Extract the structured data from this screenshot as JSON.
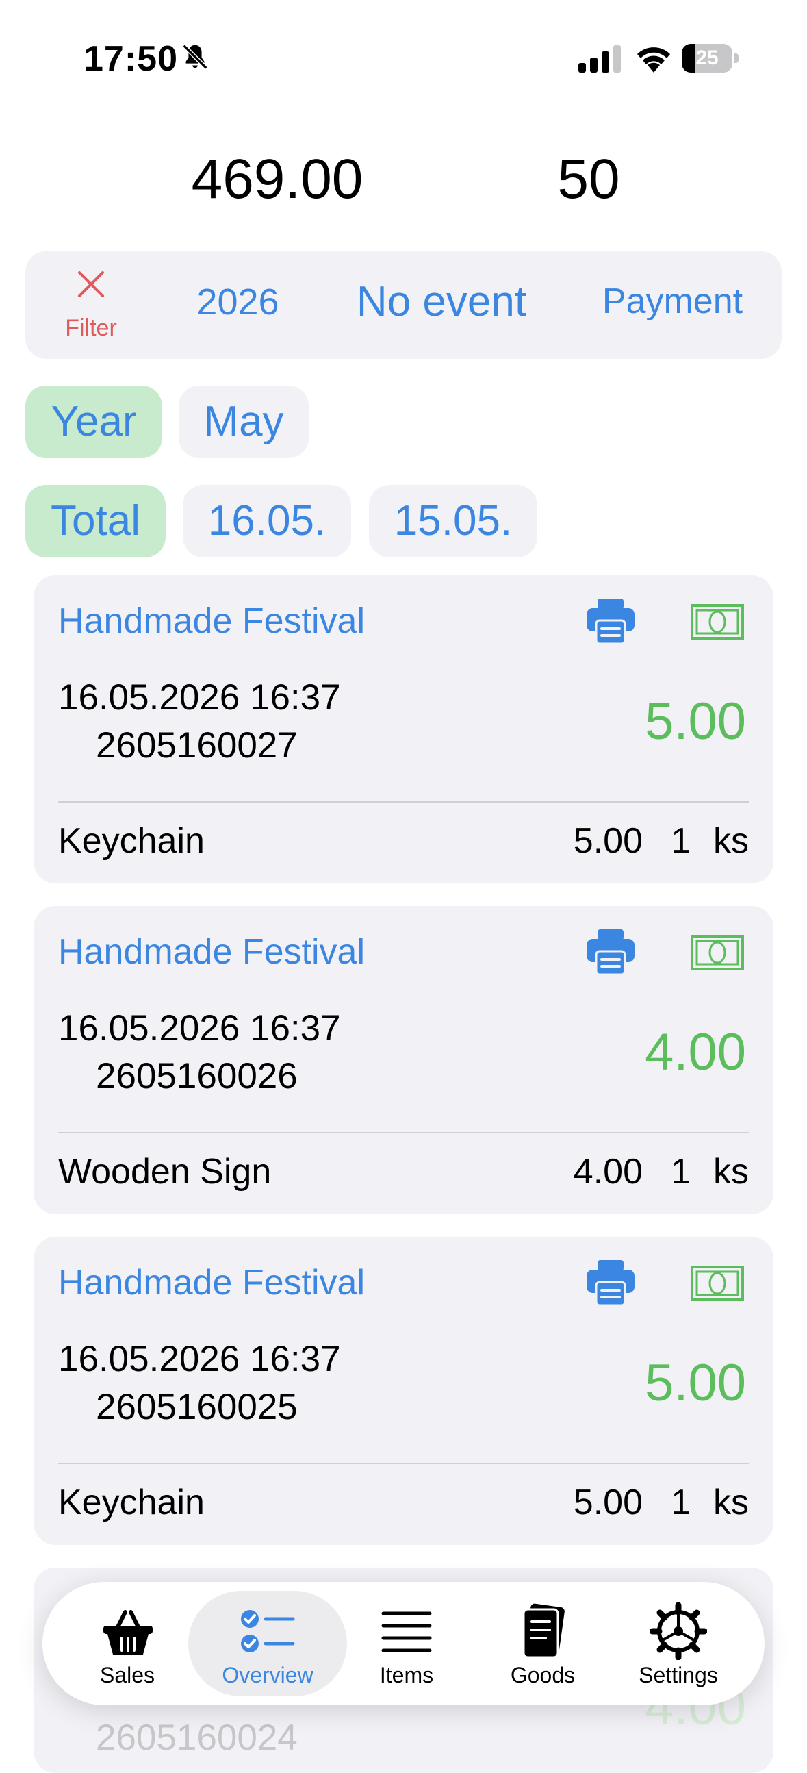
{
  "status_bar": {
    "time": "17:50",
    "battery": "25",
    "battery_level": 0.25
  },
  "summary": {
    "total": "469.00",
    "count": "50"
  },
  "filter_bar": {
    "filter_label": "Filter",
    "year": "2026",
    "event": "No event",
    "payment": "Payment"
  },
  "period_chips": [
    {
      "label": "Year",
      "active": true
    },
    {
      "label": "May",
      "active": false
    }
  ],
  "day_chips": [
    {
      "label": "Total",
      "active": true
    },
    {
      "label": "16.05.",
      "active": false
    },
    {
      "label": "15.05.",
      "active": false
    }
  ],
  "sales": [
    {
      "event": "Handmade Festival",
      "datetime": "16.05.2026 16:37",
      "number": "2605160027",
      "amount": "5.00",
      "item": "Keychain",
      "price": "5.00",
      "qty": "1",
      "unit": "ks"
    },
    {
      "event": "Handmade Festival",
      "datetime": "16.05.2026 16:37",
      "number": "2605160026",
      "amount": "4.00",
      "item": "Wooden Sign",
      "price": "4.00",
      "qty": "1",
      "unit": "ks"
    },
    {
      "event": "Handmade Festival",
      "datetime": "16.05.2026 16:37",
      "number": "2605160025",
      "amount": "5.00",
      "item": "Keychain",
      "price": "5.00",
      "qty": "1",
      "unit": "ks"
    }
  ],
  "partial_card": {
    "number": "2605160024",
    "amount": "4.00"
  },
  "tabs": [
    {
      "label": "Sales",
      "icon": "basket-icon"
    },
    {
      "label": "Overview",
      "icon": "checklist-icon",
      "selected": true
    },
    {
      "label": "Items",
      "icon": "list-icon"
    },
    {
      "label": "Goods",
      "icon": "notebook-icon"
    },
    {
      "label": "Settings",
      "icon": "gear-icon"
    }
  ],
  "colors": {
    "accent": "#3b86e0",
    "amount_green": "#5bbd5b",
    "filter_red": "#e05a5a",
    "chip_active": "#c7ebcc",
    "card_bg": "#f1f1f6"
  }
}
